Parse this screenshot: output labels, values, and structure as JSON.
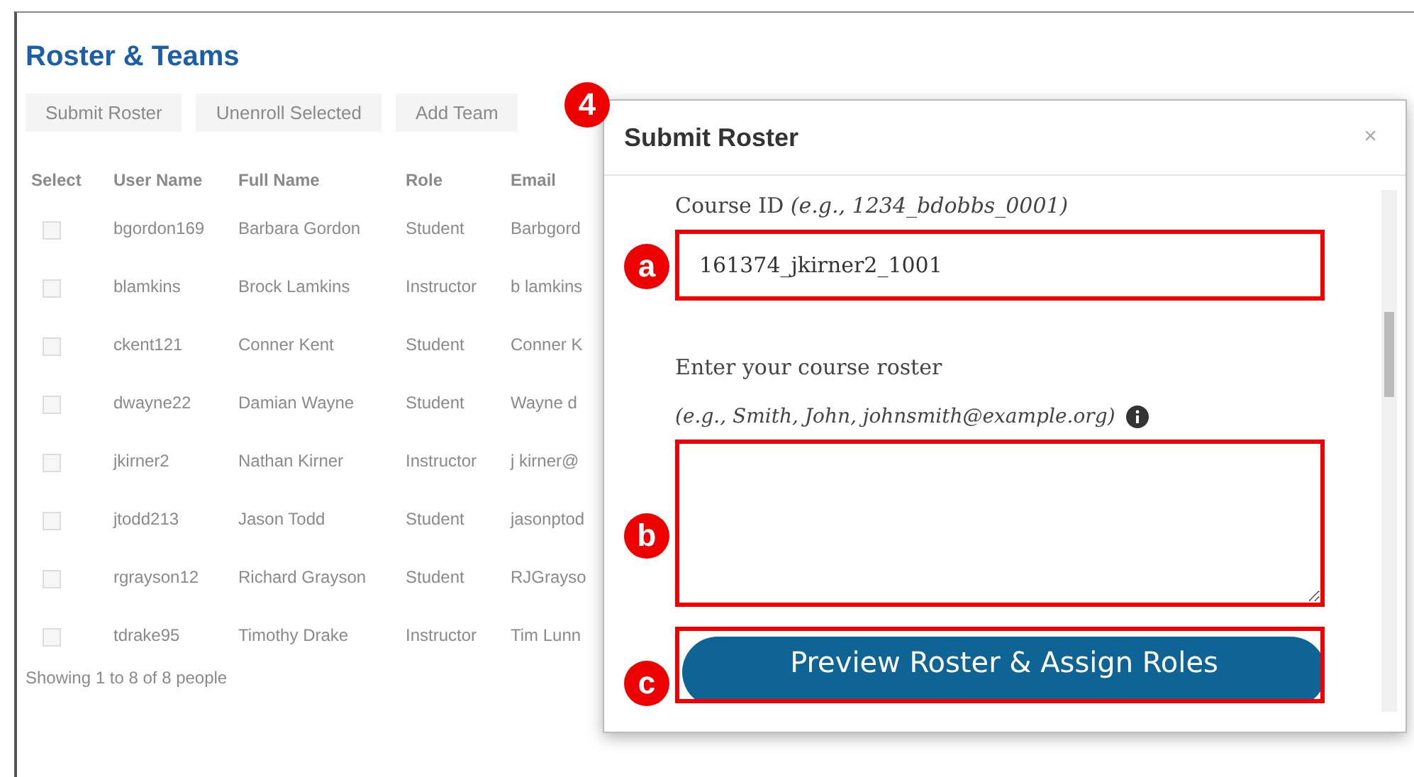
{
  "page": {
    "title": "Roster & Teams"
  },
  "toolbar": [
    "Submit Roster",
    "Unenroll Selected",
    "Add Team"
  ],
  "table": {
    "select_header": "Select",
    "columns": [
      "User Name",
      "Full Name",
      "Role",
      "Email"
    ],
    "rows": [
      {
        "checked": false,
        "cells": [
          "bgordon169",
          "Barbara Gordon",
          "Student",
          "Barbgord"
        ]
      },
      {
        "checked": false,
        "cells": [
          "blamkins",
          "Brock Lamkins",
          "Instructor",
          "b lamkins"
        ]
      },
      {
        "checked": false,
        "cells": [
          "ckent121",
          "Conner Kent",
          "Student",
          "Conner K"
        ]
      },
      {
        "checked": false,
        "cells": [
          "dwayne22",
          "Damian Wayne",
          "Student",
          "Wayne d"
        ]
      },
      {
        "checked": false,
        "cells": [
          "jkirner2",
          "Nathan Kirner",
          "Instructor",
          "j kirner@"
        ]
      },
      {
        "checked": false,
        "cells": [
          "jtodd213",
          "Jason Todd",
          "Student",
          "jasonptod"
        ]
      },
      {
        "checked": false,
        "cells": [
          "rgrayson12",
          "Richard Grayson",
          "Student",
          "RJGrayso"
        ]
      },
      {
        "checked": false,
        "cells": [
          "tdrake95",
          "Timothy Drake",
          "Instructor",
          "Tim Lunn"
        ]
      }
    ]
  },
  "footer": "Showing 1 to 8 of 8 people",
  "dialog": {
    "title": "Submit Roster",
    "close": "×",
    "course_id_label": "Course ID *(e.g., 1234_bdobbs_0001)*",
    "course_id_value": "161374_jkirner2_1001",
    "roster_label": "Enter your course roster",
    "roster_hint": "(e.g., Smith, John, johnsmith@example.org)",
    "button": "Preview Roster & Assign Roles"
  },
  "callouts": [
    "4",
    "a",
    "b",
    "c"
  ]
}
